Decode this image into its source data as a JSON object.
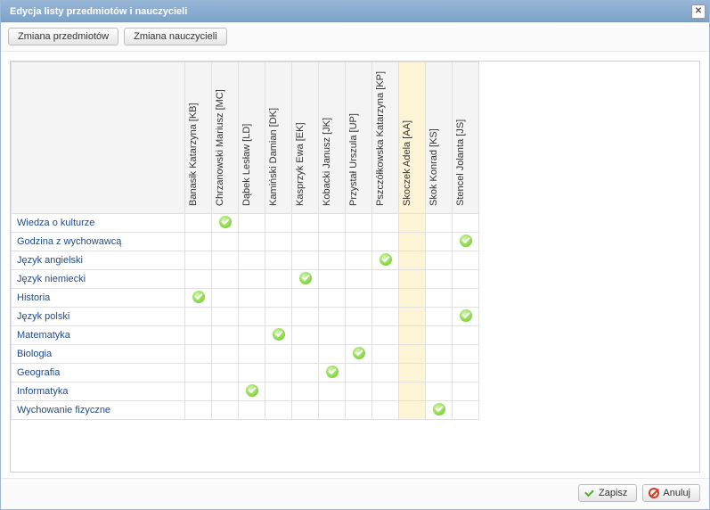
{
  "window": {
    "title": "Edycja listy przedmiotów i nauczycieli"
  },
  "toolbar": {
    "change_subjects": "Zmiana przedmiotów",
    "change_teachers": "Zmiana nauczycieli"
  },
  "teachers": [
    {
      "label": "Banasik Katarzyna [KB]",
      "highlight": false
    },
    {
      "label": "Chrzanowski Mariusz [MC]",
      "highlight": false
    },
    {
      "label": "Dąbek Lesław [LD]",
      "highlight": false
    },
    {
      "label": "Kamiński Damian [DK]",
      "highlight": false
    },
    {
      "label": "Kasprzyk Ewa [EK]",
      "highlight": false
    },
    {
      "label": "Kobacki Janusz [JK]",
      "highlight": false
    },
    {
      "label": "Przystał Urszula [UP]",
      "highlight": false
    },
    {
      "label": "Pszczółkowska Katarzyna [KP]",
      "highlight": false
    },
    {
      "label": "Skoczek Adela [AA]",
      "highlight": true
    },
    {
      "label": "Skok Konrad [KS]",
      "highlight": false
    },
    {
      "label": "Stencel Jolanta [JS]",
      "highlight": false
    }
  ],
  "subjects": [
    {
      "label": "Wiedza o kulturze",
      "marks": [
        0,
        1,
        0,
        0,
        0,
        0,
        0,
        0,
        0,
        0,
        0
      ]
    },
    {
      "label": "Godzina z wychowawcą",
      "marks": [
        0,
        0,
        0,
        0,
        0,
        0,
        0,
        0,
        0,
        0,
        1
      ]
    },
    {
      "label": "Język angielski",
      "marks": [
        0,
        0,
        0,
        0,
        0,
        0,
        0,
        1,
        0,
        0,
        0
      ]
    },
    {
      "label": "Język niemiecki",
      "marks": [
        0,
        0,
        0,
        0,
        1,
        0,
        0,
        0,
        0,
        0,
        0
      ]
    },
    {
      "label": "Historia",
      "marks": [
        1,
        0,
        0,
        0,
        0,
        0,
        0,
        0,
        0,
        0,
        0
      ]
    },
    {
      "label": "Język polski",
      "marks": [
        0,
        0,
        0,
        0,
        0,
        0,
        0,
        0,
        0,
        0,
        1
      ]
    },
    {
      "label": "Matematyka",
      "marks": [
        0,
        0,
        0,
        1,
        0,
        0,
        0,
        0,
        0,
        0,
        0
      ]
    },
    {
      "label": "Biologia",
      "marks": [
        0,
        0,
        0,
        0,
        0,
        0,
        1,
        0,
        0,
        0,
        0
      ]
    },
    {
      "label": "Geografia",
      "marks": [
        0,
        0,
        0,
        0,
        0,
        1,
        0,
        0,
        0,
        0,
        0
      ]
    },
    {
      "label": "Informatyka",
      "marks": [
        0,
        0,
        1,
        0,
        0,
        0,
        0,
        0,
        0,
        0,
        0
      ]
    },
    {
      "label": "Wychowanie fizyczne",
      "marks": [
        0,
        0,
        0,
        0,
        0,
        0,
        0,
        0,
        0,
        1,
        0
      ]
    }
  ],
  "footer": {
    "save": "Zapisz",
    "cancel": "Anuluj"
  }
}
